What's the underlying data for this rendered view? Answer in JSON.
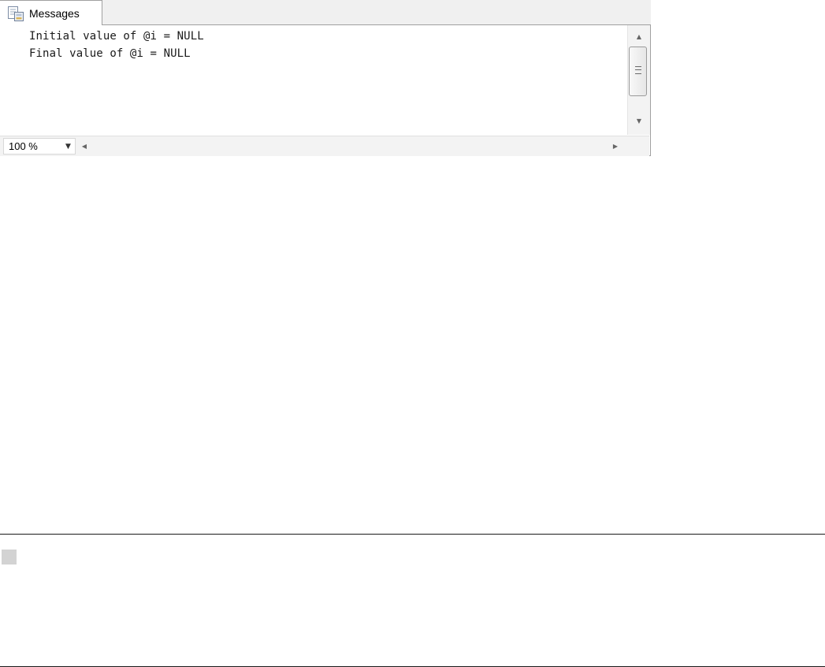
{
  "messages_tab": {
    "label": "Messages",
    "icon": "messages-document-icon"
  },
  "output": {
    "lines": [
      "Initial value of @i = NULL",
      "Final value of @i = NULL"
    ]
  },
  "status_bar": {
    "zoom": "100 %",
    "zoom_icon": "chevron-down-icon"
  },
  "scrollbars": {
    "up_icon": "arrow-up-icon",
    "down_icon": "arrow-down-icon",
    "left_icon": "arrow-left-icon",
    "right_icon": "arrow-right-icon"
  },
  "colors": {
    "pane_border": "#a0a0a0",
    "tabstrip_bg": "#f0f0f0",
    "scrollbar_bg": "#f3f3f3",
    "rule": "#1a1a1a",
    "placeholder": "#d3d3d3"
  }
}
